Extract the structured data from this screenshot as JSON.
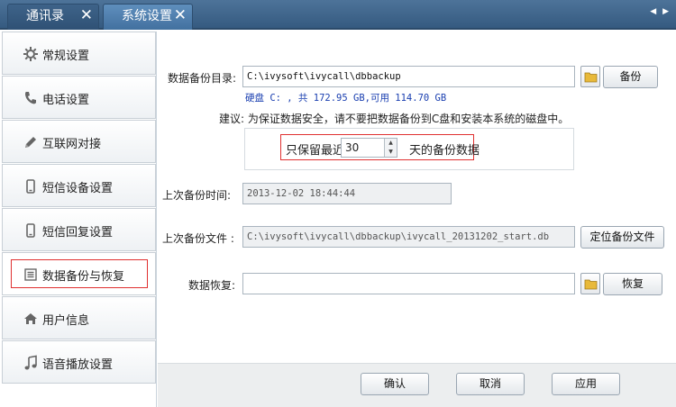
{
  "tabs": [
    {
      "label": "通讯录",
      "close": "✕"
    },
    {
      "label": "系统设置",
      "close": "✕"
    }
  ],
  "scroll_arrows": "◀ ▶",
  "sidebar": {
    "items": [
      {
        "label": "常规设置",
        "icon": "gear-icon"
      },
      {
        "label": "电话设置",
        "icon": "phone-icon"
      },
      {
        "label": "互联网对接",
        "icon": "pencil-icon"
      },
      {
        "label": "短信设备设置",
        "icon": "mobile-icon"
      },
      {
        "label": "短信回复设置",
        "icon": "mobile-icon"
      },
      {
        "label": "数据备份与恢复",
        "icon": "list-icon"
      },
      {
        "label": "用户信息",
        "icon": "home-icon"
      },
      {
        "label": "语音播放设置",
        "icon": "music-icon"
      }
    ],
    "active_index": 5
  },
  "backup": {
    "dir_label": "数据备份目录:",
    "dir_value": "C:\\ivysoft\\ivycall\\dbbackup",
    "backup_button": "备份",
    "disk_info": "硬盘 C: , 共 172.95 GB,可用 114.70 GB",
    "advice": "建议: 为保证数据安全，请不要把数据备份到C盘和安装本系统的磁盘中。",
    "keep_prefix": "只保留最近",
    "keep_days": "30",
    "keep_suffix": "天的备份数据",
    "last_time_label": "上次备份时间:",
    "last_time_value": "2013-12-02 18:44:44",
    "last_file_label": "上次备份文件 :",
    "last_file_value": "C:\\ivysoft\\ivycall\\dbbackup\\ivycall_20131202_start.db",
    "locate_button": "定位备份文件",
    "restore_label": "数据恢复:",
    "restore_value": "",
    "restore_button": "恢复"
  },
  "footer": {
    "ok": "确认",
    "cancel": "取消",
    "apply": "应用"
  },
  "colors": {
    "tabbar": "#3d6389",
    "highlight_box": "#e03030",
    "disk_text": "#1a3fb0"
  }
}
